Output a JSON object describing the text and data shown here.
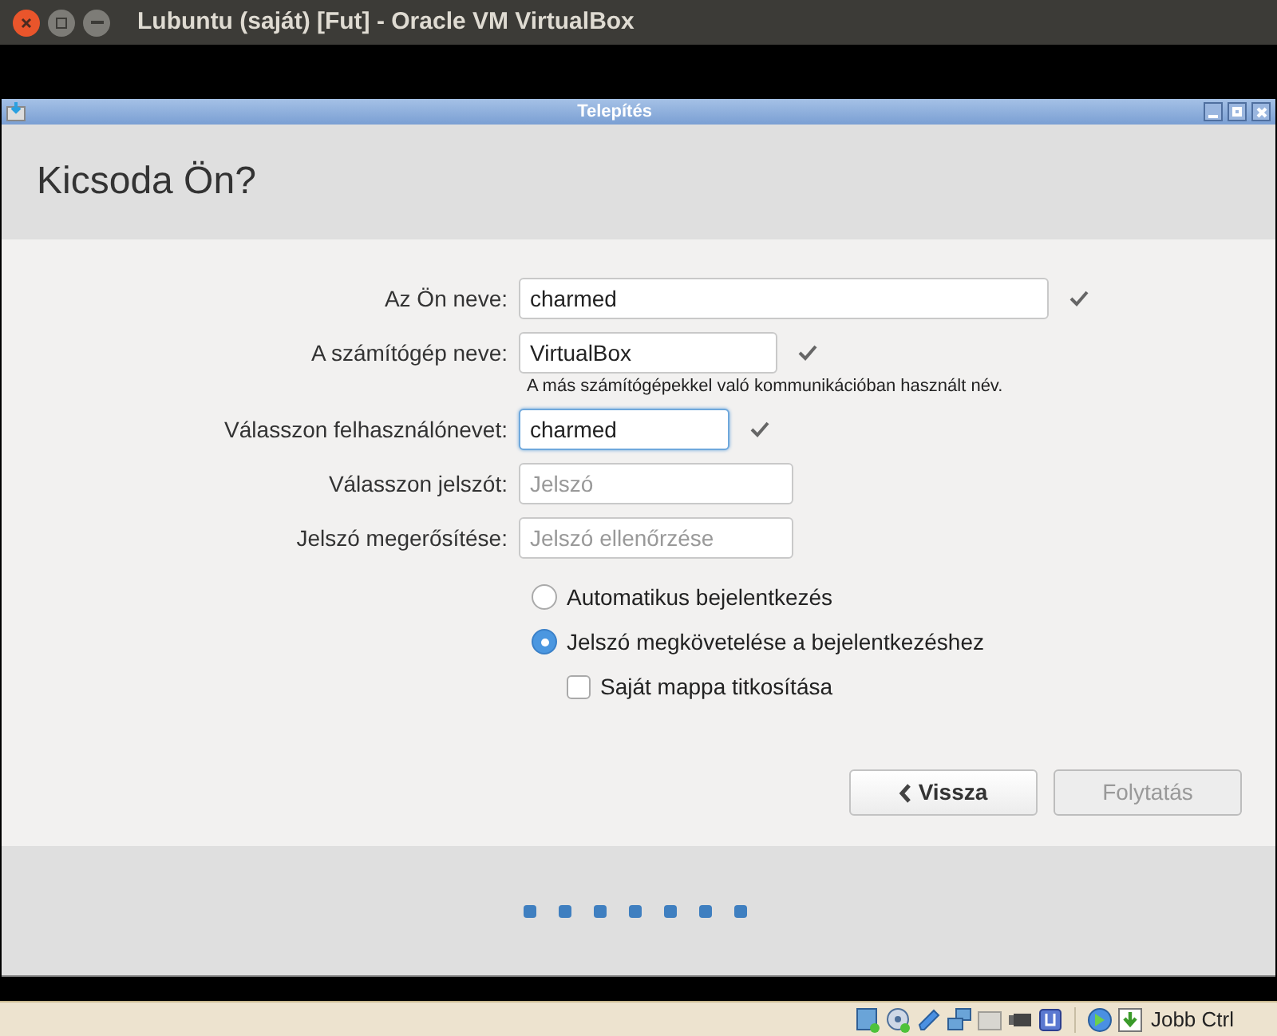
{
  "window": {
    "title": "Lubuntu (saját) [Fut] - Oracle VM VirtualBox"
  },
  "dialog": {
    "title": "Telepítés",
    "heading": "Kicsoda Ön?"
  },
  "fields": [
    {
      "label": "Az Ön neve:",
      "value": "charmed",
      "valid": true,
      "focused": false
    },
    {
      "label": "A számítógép neve:",
      "value": "VirtualBox",
      "valid": true,
      "focused": false,
      "hint": "A más számítógépekkel való kommunikációban használt név."
    },
    {
      "label": "Válasszon felhasználónevet:",
      "value": "charmed",
      "valid": true,
      "focused": true
    },
    {
      "label": "Válasszon jelszót:",
      "placeholder": "Jelszó",
      "valid": false,
      "focused": false
    },
    {
      "label": "Jelszó megerősítése:",
      "placeholder": "Jelszó ellenőrzése",
      "valid": false,
      "focused": false
    }
  ],
  "login_options": [
    {
      "label": "Automatikus bejelentkezés",
      "selected": false
    },
    {
      "label": "Jelszó megkövetelése a bejelentkezéshez",
      "selected": true
    }
  ],
  "encrypt": {
    "label": "Saját mappa titkosítása",
    "checked": false
  },
  "buttons": [
    {
      "label": "Vissza",
      "disabled": false,
      "kind": "back"
    },
    {
      "label": "Folytatás",
      "disabled": true,
      "kind": "next"
    }
  ],
  "status_bar": {
    "host_key": "Jobb Ctrl"
  }
}
